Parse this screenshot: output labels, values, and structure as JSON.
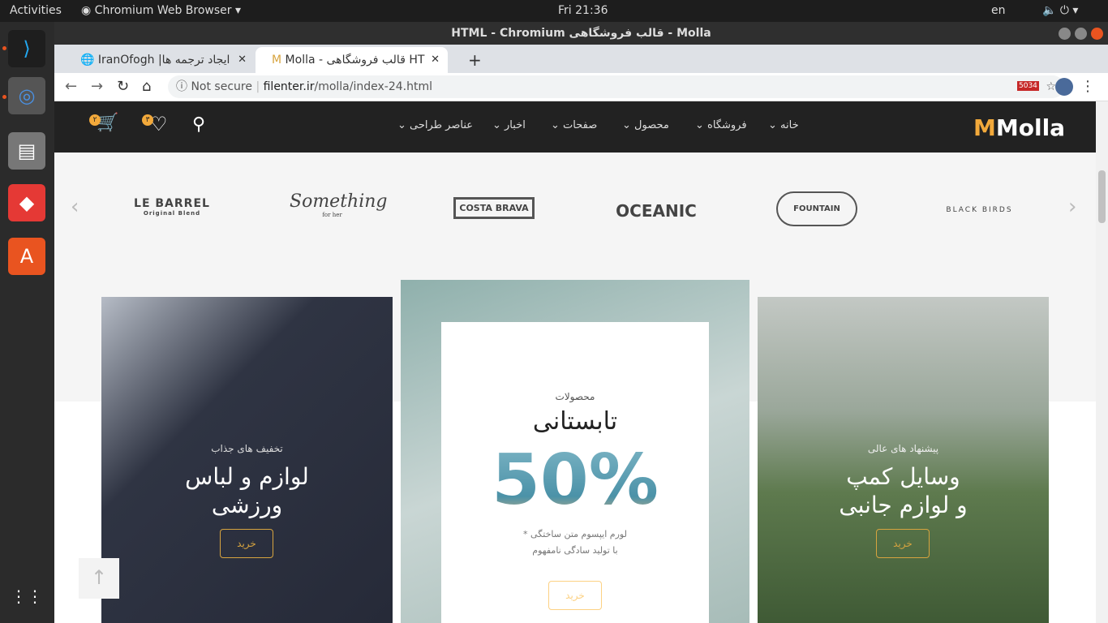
{
  "system": {
    "activities": "Activities",
    "app_menu": "Chromium Web Browser",
    "clock": "Fri 21:36",
    "lang": "en"
  },
  "window": {
    "title": "HTML - Chromium قالب فروشگاهی - Molla"
  },
  "tabs": [
    {
      "label": "IranOfogh |ایجاد ترجمه ها"
    },
    {
      "label": "Molla - قالب فروشگاهی HT"
    }
  ],
  "address": {
    "security": "Not secure",
    "url_host": "filenter.ir",
    "url_path": "/molla/index-24.html"
  },
  "extension_badge": "5034",
  "site": {
    "logo": "Molla",
    "nav": [
      "خانه",
      "فروشگاه",
      "محصول",
      "صفحات",
      "اخبار",
      "عناصر طراحی"
    ],
    "cart_count": "۲",
    "wishlist_count": "۳",
    "brands": [
      "LE BARREL",
      "Something",
      "COSTA BRAVA",
      "OCEANIC",
      "FOUNTAIN",
      "BLACK BIRDS"
    ],
    "brand_sub": {
      "le_barrel": "Original Blend",
      "something": "for her"
    },
    "banners": [
      {
        "subtitle": "تخفیف های جذاب",
        "title1": "لوازم و لباس",
        "title2": "ورزشی",
        "button": "خرید"
      },
      {
        "subtitle": "محصولات",
        "title": "تابستانی",
        "discount": "50%",
        "desc1": "* لورم ایپسوم متن ساختگی",
        "desc2": "با تولید سادگی نامفهوم",
        "button": "خرید"
      },
      {
        "subtitle": "پیشنهاد های عالی",
        "title1": "وسایل کمپ",
        "title2": "و لوازم جانبی",
        "button": "خرید"
      }
    ]
  },
  "colors": {
    "accent": "#f2a93b",
    "nav_bg": "#222222"
  }
}
